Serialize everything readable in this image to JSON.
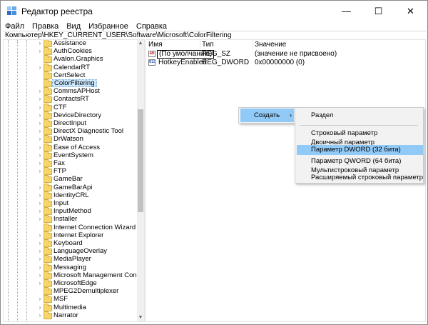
{
  "window": {
    "title": "Редактор реестра",
    "controls": {
      "minimize": "—",
      "maximize": "☐",
      "close": "✕"
    }
  },
  "menu": [
    "Файл",
    "Правка",
    "Вид",
    "Избранное",
    "Справка"
  ],
  "address": "Компьютер\\HKEY_CURRENT_USER\\Software\\Microsoft\\ColorFiltering",
  "tree": {
    "selected": "ColorFiltering",
    "items": [
      {
        "label": "Assistance",
        "expandable": true
      },
      {
        "label": "AuthCookies",
        "expandable": true
      },
      {
        "label": "Avalon.Graphics",
        "expandable": false
      },
      {
        "label": "CalendarRT",
        "expandable": true
      },
      {
        "label": "CertSelect",
        "expandable": false
      },
      {
        "label": "ColorFiltering",
        "expandable": false
      },
      {
        "label": "CommsAPHost",
        "expandable": true
      },
      {
        "label": "ContactsRT",
        "expandable": true
      },
      {
        "label": "CTF",
        "expandable": true
      },
      {
        "label": "DeviceDirectory",
        "expandable": true
      },
      {
        "label": "DirectInput",
        "expandable": true
      },
      {
        "label": "DirectX Diagnostic Tool",
        "expandable": true
      },
      {
        "label": "DrWatson",
        "expandable": true
      },
      {
        "label": "Ease of Access",
        "expandable": true
      },
      {
        "label": "EventSystem",
        "expandable": true
      },
      {
        "label": "Fax",
        "expandable": true
      },
      {
        "label": "FTP",
        "expandable": true
      },
      {
        "label": "GameBar",
        "expandable": false
      },
      {
        "label": "GameBarApi",
        "expandable": true
      },
      {
        "label": "IdentityCRL",
        "expandable": true
      },
      {
        "label": "Input",
        "expandable": true
      },
      {
        "label": "InputMethod",
        "expandable": true
      },
      {
        "label": "Installer",
        "expandable": true
      },
      {
        "label": "Internet Connection Wizard",
        "expandable": false
      },
      {
        "label": "Internet Explorer",
        "expandable": true
      },
      {
        "label": "Keyboard",
        "expandable": true
      },
      {
        "label": "LanguageOverlay",
        "expandable": true
      },
      {
        "label": "MediaPlayer",
        "expandable": true
      },
      {
        "label": "Messaging",
        "expandable": true
      },
      {
        "label": "Microsoft Management Console",
        "expandable": true
      },
      {
        "label": "MicrosoftEdge",
        "expandable": true
      },
      {
        "label": "MPEG2Demultiplexer",
        "expandable": false
      },
      {
        "label": "MSF",
        "expandable": true
      },
      {
        "label": "Multimedia",
        "expandable": true
      },
      {
        "label": "Narrator",
        "expandable": true
      }
    ]
  },
  "values": {
    "columns": [
      "Имя",
      "Тип",
      "Значение"
    ],
    "rows": [
      {
        "icon": "ab",
        "name": "(По умолчанию)",
        "type": "REG_SZ",
        "data": "(значение не присвоено)"
      },
      {
        "icon": "011",
        "name": "HotkeyEnabled",
        "type": "REG_DWORD",
        "data": "0x00000000 (0)"
      }
    ]
  },
  "context_menu": {
    "create_label": "Создать",
    "submenu": [
      "Раздел",
      "Строковый параметр",
      "Двоичный параметр",
      "Параметр DWORD (32 бита)",
      "Параметр QWORD (64 бита)",
      "Мультистроковый параметр",
      "Расширяемый строковый параметр"
    ],
    "highlighted_index": 3
  },
  "colors": {
    "selection": "#cce8ff",
    "menu_hover": "#91c9f7",
    "folder": "#f6d66b"
  }
}
